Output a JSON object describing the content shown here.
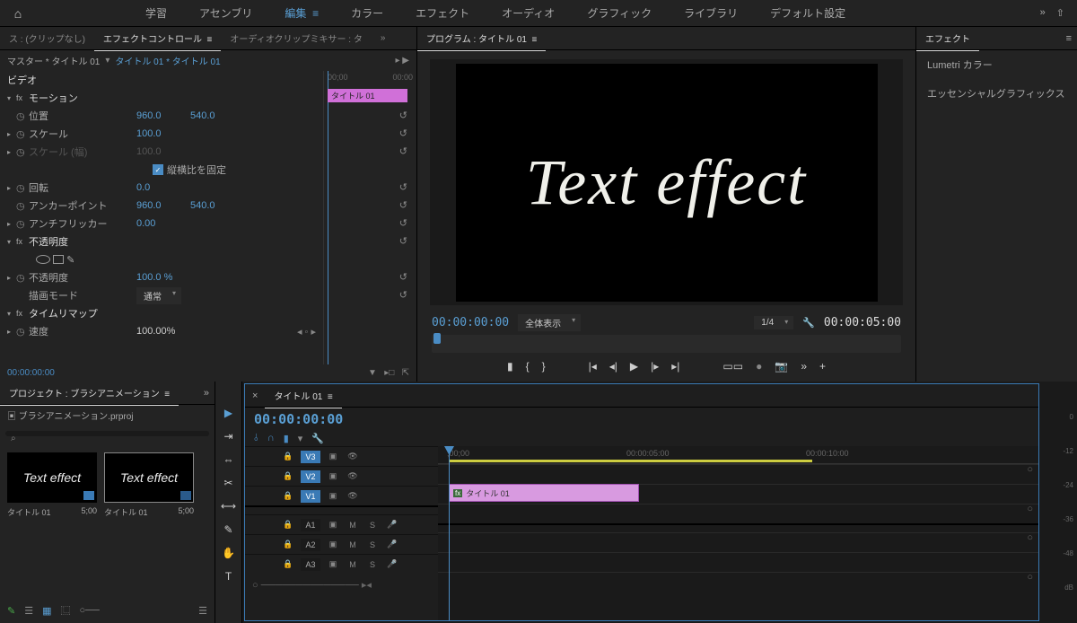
{
  "topbar": {
    "workspaces": [
      "学習",
      "アセンブリ",
      "編集",
      "カラー",
      "エフェクト",
      "オーディオ",
      "グラフィック",
      "ライブラリ",
      "デフォルト設定"
    ],
    "active_workspace_index": 2
  },
  "source_tabs": {
    "source": "ス : (クリップなし)",
    "effect_controls": "エフェクトコントロール",
    "audio_mixer": "オーディオクリップミキサー : タ"
  },
  "effect_controls": {
    "master": "マスター * タイトル 01",
    "clip": "タイトル 01 * タイトル 01",
    "video_heading": "ビデオ",
    "mini_time_start": "00;00",
    "mini_time_end": "00:00",
    "mini_clip_label": "タイトル 01",
    "current_time": "00:00:00:00",
    "motion": {
      "label": "モーション",
      "position": {
        "label": "位置",
        "x": "960.0",
        "y": "540.0"
      },
      "scale": {
        "label": "スケール",
        "val": "100.0"
      },
      "scale_w": {
        "label": "スケール (幅)",
        "val": "100.0"
      },
      "uniform": {
        "label": "縦横比を固定"
      },
      "rotation": {
        "label": "回転",
        "val": "0.0"
      },
      "anchor": {
        "label": "アンカーポイント",
        "x": "960.0",
        "y": "540.0"
      },
      "antiflicker": {
        "label": "アンチフリッカー",
        "val": "0.00"
      }
    },
    "opacity": {
      "label": "不透明度",
      "opacity_prop": {
        "label": "不透明度",
        "val": "100.0 %"
      },
      "blend": {
        "label": "描画モード",
        "val": "通常"
      }
    },
    "timeremap": {
      "label": "タイムリマップ",
      "speed": {
        "label": "速度",
        "val": "100.00%"
      }
    }
  },
  "program": {
    "tab": "プログラム : タイトル 01",
    "canvas_text": "Text effect",
    "time_left": "00:00:00:00",
    "fit": "全体表示",
    "zoom": "1/4",
    "duration": "00:00:05:00"
  },
  "effects_panel": {
    "title": "エフェクト",
    "items": [
      "Lumetri カラー",
      "エッセンシャルグラフィックス"
    ]
  },
  "project": {
    "tab": "プロジェクト : ブラシアニメーション",
    "file": "ブラシアニメーション.prproj",
    "bins": [
      {
        "label": "タイトル 01",
        "duration": "5;00",
        "thumb_text": "Text effect"
      },
      {
        "label": "タイトル 01",
        "duration": "5;00",
        "thumb_text": "Text effect"
      }
    ]
  },
  "timeline": {
    "tab": "タイトル 01",
    "timecode": "00:00:00:00",
    "ruler": {
      "t0": ";00;00",
      "t1": "00:00:05:00",
      "t2": "00:00:10:00"
    },
    "tracks": {
      "video": [
        "V3",
        "V2",
        "V1"
      ],
      "audio": [
        "A1",
        "A2",
        "A3"
      ]
    },
    "clip": {
      "label": "タイトル 01"
    },
    "meters": [
      "0",
      "-12",
      "-24",
      "-36",
      "-48",
      "dB"
    ]
  }
}
